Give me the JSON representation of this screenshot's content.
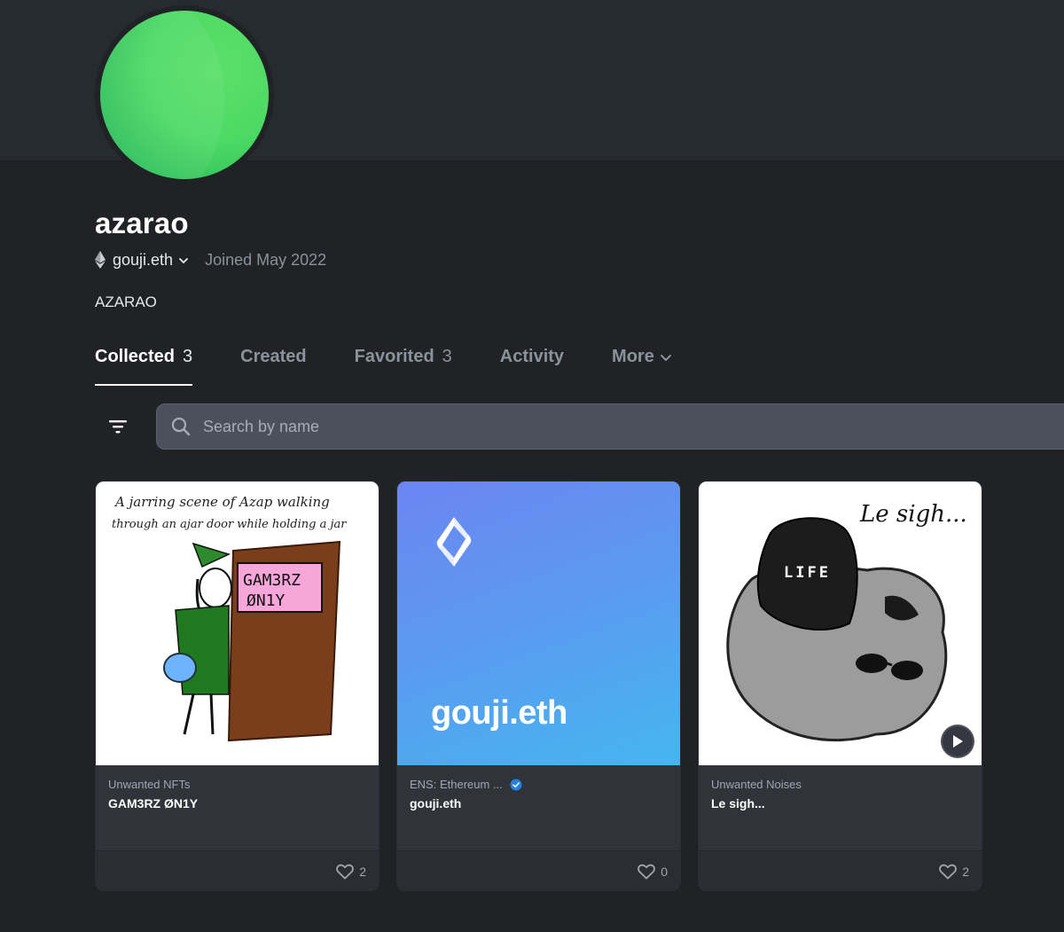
{
  "profile": {
    "username": "azarao",
    "ens_name": "gouji.eth",
    "joined": "Joined May 2022",
    "bio": "AZARAO"
  },
  "tabs": [
    {
      "label": "Collected",
      "count": "3",
      "active": true
    },
    {
      "label": "Created",
      "count": ""
    },
    {
      "label": "Favorited",
      "count": "3"
    },
    {
      "label": "Activity",
      "count": ""
    },
    {
      "label": "More",
      "count": ""
    }
  ],
  "search": {
    "placeholder": "Search by name"
  },
  "cards": [
    {
      "collection": "Unwanted NFTs",
      "name": "GAM3RZ ØN1Y",
      "likes": "2",
      "art_text": [
        "A jarring scene of Azap walking",
        "through an ajar door while holding a jar",
        "GAM3RZ",
        "ØN1Y"
      ]
    },
    {
      "collection": "ENS: Ethereum ...",
      "name": "gouji.eth",
      "likes": "0",
      "verified": true,
      "art_text": [
        "gouji.eth"
      ]
    },
    {
      "collection": "Unwanted Noises",
      "name": "Le sigh...",
      "likes": "2",
      "art_text": [
        "Le sigh...",
        "LIFE"
      ]
    }
  ],
  "colors": {
    "background": "#202225",
    "banner": "#262b2f",
    "card": "#303339",
    "avatar": "#4cd964",
    "ens_gradient_start": "#6c85f1",
    "ens_gradient_end": "#45b6ef",
    "verified": "#2081e2"
  },
  "icons": [
    "ethereum-icon",
    "chevron-down-icon",
    "filter-icon",
    "search-icon",
    "heart-icon",
    "verified-icon",
    "play-icon",
    "ens-logo-icon"
  ]
}
